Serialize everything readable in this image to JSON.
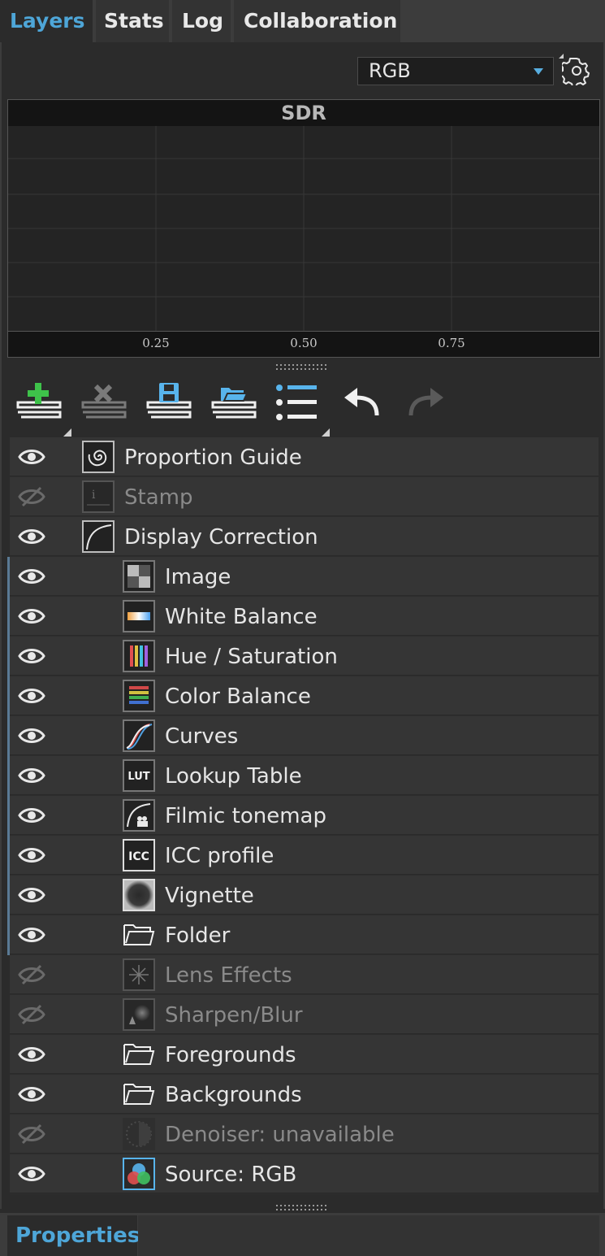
{
  "tabs": [
    {
      "label": "Layers",
      "active": true
    },
    {
      "label": "Stats",
      "active": false
    },
    {
      "label": "Log",
      "active": false
    },
    {
      "label": "Collaboration",
      "active": false
    }
  ],
  "channel": {
    "selected": "RGB"
  },
  "histogram": {
    "title": "SDR",
    "ticks": [
      "0.25",
      "0.50",
      "0.75"
    ]
  },
  "toolbar": {
    "add_layer": "add-layer",
    "remove_layer": "remove-layer",
    "save_layer": "save-layer",
    "open_layer": "open-layer",
    "layer_menu": "layer-menu",
    "undo": "undo",
    "redo": "redo"
  },
  "layers": [
    {
      "label": "Proportion Guide",
      "visible": true,
      "enabled": true,
      "icon": "spiral-icon",
      "depth": 0
    },
    {
      "label": "Stamp",
      "visible": false,
      "enabled": false,
      "icon": "stamp-icon",
      "depth": 0
    },
    {
      "label": "Display Correction",
      "visible": true,
      "enabled": true,
      "icon": "curve-icon",
      "depth": 0
    },
    {
      "label": "Image",
      "visible": true,
      "enabled": true,
      "icon": "image-icon",
      "depth": 1
    },
    {
      "label": "White Balance",
      "visible": true,
      "enabled": true,
      "icon": "white-balance-icon",
      "depth": 1
    },
    {
      "label": "Hue / Saturation",
      "visible": true,
      "enabled": true,
      "icon": "hue-saturation-icon",
      "depth": 1
    },
    {
      "label": "Color Balance",
      "visible": true,
      "enabled": true,
      "icon": "color-balance-icon",
      "depth": 1
    },
    {
      "label": "Curves",
      "visible": true,
      "enabled": true,
      "icon": "curves-icon",
      "depth": 1
    },
    {
      "label": "Lookup Table",
      "visible": true,
      "enabled": true,
      "icon": "lut-icon",
      "depth": 1
    },
    {
      "label": "Filmic tonemap",
      "visible": true,
      "enabled": true,
      "icon": "filmic-icon",
      "depth": 1
    },
    {
      "label": "ICC profile",
      "visible": true,
      "enabled": true,
      "icon": "icc-icon",
      "depth": 1
    },
    {
      "label": "Vignette",
      "visible": true,
      "enabled": true,
      "icon": "vignette-icon",
      "depth": 1
    },
    {
      "label": "Folder",
      "visible": true,
      "enabled": true,
      "icon": "folder-icon",
      "depth": 1
    },
    {
      "label": "Lens Effects",
      "visible": false,
      "enabled": false,
      "icon": "lens-effects-icon",
      "depth": 1
    },
    {
      "label": "Sharpen/Blur",
      "visible": false,
      "enabled": false,
      "icon": "sharpen-blur-icon",
      "depth": 1
    },
    {
      "label": "Foregrounds",
      "visible": true,
      "enabled": true,
      "icon": "folder-icon",
      "depth": 1
    },
    {
      "label": "Backgrounds",
      "visible": true,
      "enabled": true,
      "icon": "folder-icon",
      "depth": 1
    },
    {
      "label": "Denoiser: unavailable",
      "visible": false,
      "enabled": false,
      "icon": "denoiser-icon",
      "depth": 1
    },
    {
      "label": "Source: RGB",
      "visible": true,
      "enabled": true,
      "icon": "source-rgb-icon",
      "depth": 1
    }
  ],
  "bottom_tab": {
    "label": "Properties"
  },
  "colors": {
    "accent": "#4ea6d8",
    "add_green": "#3ec24a",
    "save_blue": "#58b4ec"
  }
}
